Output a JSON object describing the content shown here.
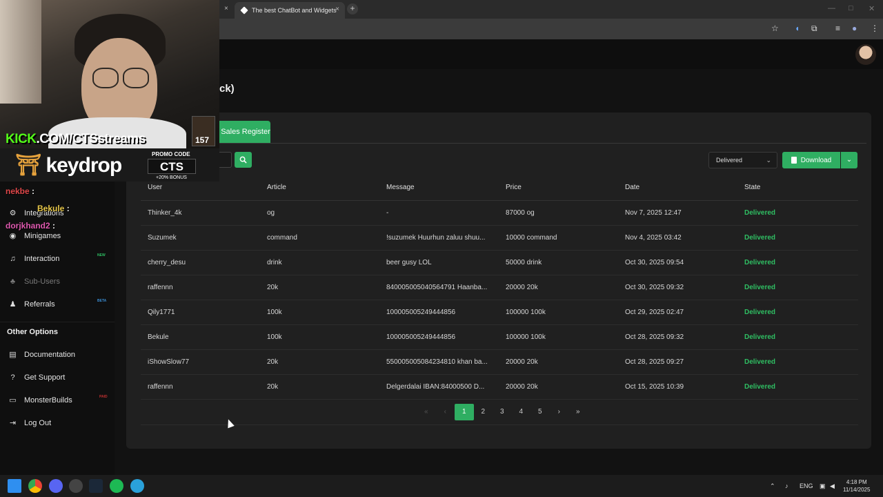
{
  "browser": {
    "tab_title": "The best ChatBot and Widgets",
    "tab_close": "×",
    "new_tab": "+"
  },
  "page": {
    "title_fragment": "ck)",
    "active_tab": "Sales Register",
    "status_filter": "Delivered",
    "download_label": "Download"
  },
  "table": {
    "headers": [
      "User",
      "Article",
      "Message",
      "Price",
      "Date",
      "State"
    ],
    "rows": [
      [
        "Thinker_4k",
        "og",
        "-",
        "87000 og",
        "Nov 7, 2025 12:47",
        "Delivered"
      ],
      [
        "Suzumek",
        "command",
        "!suzumek Huurhun zaluu shuu...",
        "10000 command",
        "Nov 4, 2025 03:42",
        "Delivered"
      ],
      [
        "cherry_desu",
        "drink",
        "beer gusy LOL",
        "50000 drink",
        "Oct 30, 2025 09:54",
        "Delivered"
      ],
      [
        "raffennn",
        "20k",
        "840005005040564791 Haanba...",
        "20000 20k",
        "Oct 30, 2025 09:32",
        "Delivered"
      ],
      [
        "Qily1771",
        "100k",
        "100005005249444856",
        "100000 100k",
        "Oct 29, 2025 02:47",
        "Delivered"
      ],
      [
        "Bekule",
        "100k",
        "100005005249444856",
        "100000 100k",
        "Oct 28, 2025 09:32",
        "Delivered"
      ],
      [
        "iShowSlow77",
        "20k",
        "550005005084234810 khan ba...",
        "20000 20k",
        "Oct 28, 2025 09:27",
        "Delivered"
      ],
      [
        "raffennn",
        "20k",
        "Delgerdalai IBAN:84000500 D...",
        "20000 20k",
        "Oct 15, 2025 10:39",
        "Delivered"
      ]
    ]
  },
  "pagination": {
    "first": "«",
    "prev": "‹",
    "next": "›",
    "last": "»",
    "pages": [
      "1",
      "2",
      "3",
      "4",
      "5"
    ],
    "active": "1"
  },
  "sidebar": {
    "items": [
      {
        "label": "Integrations",
        "badge": ""
      },
      {
        "label": "Minigames",
        "badge": ""
      },
      {
        "label": "Interaction",
        "badge": "NEW"
      },
      {
        "label": "Sub-Users",
        "badge": ""
      },
      {
        "label": "Referrals",
        "badge": "BETA"
      }
    ],
    "other_heading": "Other Options",
    "other_items": [
      {
        "label": "Documentation",
        "badge": ""
      },
      {
        "label": "Get Support",
        "badge": ""
      },
      {
        "label": "MonsterBuilds",
        "badge": "PAID"
      },
      {
        "label": "Log Out",
        "badge": ""
      }
    ]
  },
  "overlay": {
    "kick_prefix": "KICK",
    "kick_rest": ".COM/CTSstreams",
    "badge_num": "157",
    "brand": "keydrop",
    "promo_label": "PROMO CODE",
    "promo_code": "CTS",
    "promo_bonus": "+20% BONUS",
    "chat": [
      {
        "user": "nekbe",
        "text": ":",
        "color": "#e0484a"
      },
      {
        "user": "Bekule",
        "text": ":",
        "color": "#e9c94a"
      },
      {
        "user": "dorjkhand2",
        "text": ":",
        "color": "#e05ab0"
      }
    ]
  },
  "taskbar": {
    "lang": "ENG",
    "time": "4:18 PM",
    "date": "11/14/2025"
  }
}
